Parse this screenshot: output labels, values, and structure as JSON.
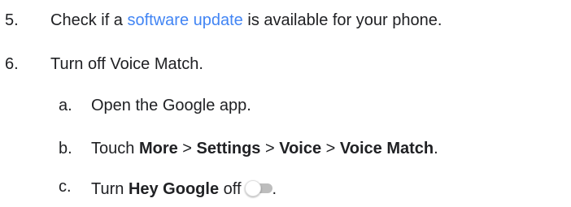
{
  "steps": [
    {
      "number": "5.",
      "text_before": "Check if a ",
      "link_text": "software update",
      "text_after": " is available for your phone."
    },
    {
      "number": "6.",
      "text": "Turn off Voice Match.",
      "substeps": [
        {
          "letter": "a.",
          "text": "Open the Google app."
        },
        {
          "letter": "b.",
          "prefix": "Touch ",
          "path": [
            "More",
            "Settings",
            "Voice",
            "Voice Match"
          ],
          "separator": " > ",
          "suffix": "."
        },
        {
          "letter": "c.",
          "prefix": "Turn ",
          "bold": "Hey Google",
          "middle": " off",
          "suffix": ".",
          "toggle_state": "off"
        }
      ]
    }
  ],
  "colors": {
    "text": "#202124",
    "link": "#4285f4",
    "toggle_track": "#bdbdbd"
  }
}
